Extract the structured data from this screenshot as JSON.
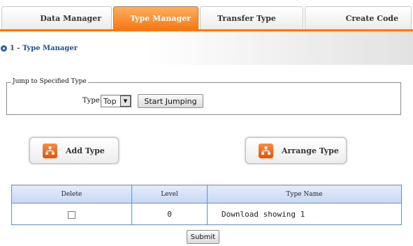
{
  "tabs": [
    {
      "label": "Data Manager",
      "active": false
    },
    {
      "label": "Type Manager",
      "active": true
    },
    {
      "label": "Transfer Type",
      "active": false
    },
    {
      "label": "Create Code",
      "active": false
    }
  ],
  "breadcrumb": {
    "text": "1 - Type Manager",
    "icon": "radio-dot-icon"
  },
  "jump": {
    "legend": "Jump to Specified Type",
    "type_label": "Type:",
    "select_value": "Top",
    "button_label": "Start Jumping"
  },
  "actions": {
    "add_label": "Add Type",
    "arrange_label": "Arrange Type",
    "icon": "tree-diagram-icon"
  },
  "table": {
    "headers": [
      "Delete",
      "Level",
      "Type Name"
    ],
    "rows": [
      {
        "delete_checked": false,
        "level": "0",
        "name": "Download showing 1"
      }
    ]
  },
  "submit_label": "Submit",
  "colors": {
    "accent_orange": "#f47a12",
    "link_blue": "#1f4fa0",
    "table_border": "#6b8fd8",
    "table_header": "#c7d7f4"
  }
}
